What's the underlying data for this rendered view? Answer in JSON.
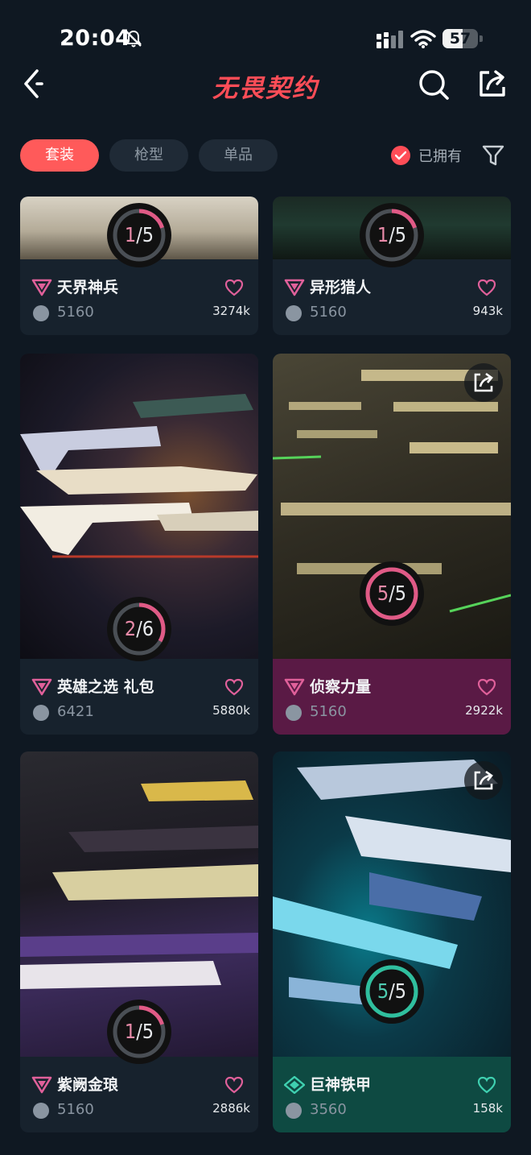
{
  "status": {
    "time": "20:04",
    "battery": "57",
    "battery_level": 0.57
  },
  "header": {
    "logo": "无畏契约"
  },
  "tabs": [
    {
      "label": "套装",
      "active": true
    },
    {
      "label": "枪型",
      "active": false
    },
    {
      "label": "单品",
      "active": false
    }
  ],
  "filter": {
    "owned_label": "已拥有",
    "owned_checked": true
  },
  "colors": {
    "accent": "#ff4d57",
    "background": "#0f1822",
    "owned_pink": "#5a1a45",
    "owned_teal": "#0e4a42"
  },
  "cards": [
    {
      "name": "天界神兵",
      "price": "5160",
      "likes": "3274k",
      "owned": "1",
      "total": "5",
      "progress": 0.2
    },
    {
      "name": "异形猎人",
      "price": "5160",
      "likes": "943k",
      "owned": "1",
      "total": "5",
      "progress": 0.2
    },
    {
      "name": "英雄之选 礼包",
      "price": "6421",
      "likes": "5880k",
      "owned": "2",
      "total": "6",
      "progress": 0.333
    },
    {
      "name": "侦察力量",
      "price": "5160",
      "likes": "2922k",
      "owned": "5",
      "total": "5",
      "progress": 1.0
    },
    {
      "name": "紫阙金琅",
      "price": "5160",
      "likes": "2886k",
      "owned": "1",
      "total": "5",
      "progress": 0.2
    },
    {
      "name": "巨神铁甲",
      "price": "3560",
      "likes": "158k",
      "owned": "5",
      "total": "5",
      "progress": 1.0
    }
  ]
}
